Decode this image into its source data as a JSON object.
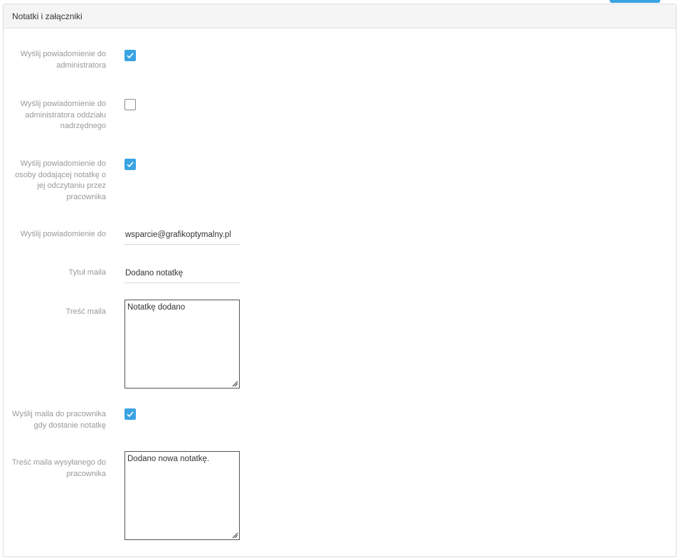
{
  "panel": {
    "title": "Notatki i załączniki"
  },
  "fields": {
    "notify_admin": {
      "label": "Wyślij powiadomienie do administratora",
      "checked": true
    },
    "notify_parent_admin": {
      "label": "Wyślij powiadomienie do administratora oddziału nadrzędnego",
      "checked": false
    },
    "notify_author": {
      "label": "Wyślij powiadomienie do osoby dodającej notatkę o jej odczytaniu przez pracownika",
      "checked": true
    },
    "notify_to": {
      "label": "Wyślij powiadomienie do",
      "value": "wsparcie@grafikoptymalny.pl"
    },
    "mail_title": {
      "label": "Tytuł maila",
      "value": "Dodano notatkę"
    },
    "mail_body": {
      "label": "Treść maila",
      "value": "Notatkę dodano"
    },
    "mail_to_employee": {
      "label": "Wyślij maila do pracownika gdy dostanie notatkę",
      "checked": true
    },
    "employee_mail_body": {
      "label": "Treść maila wysyłanego do pracownika",
      "value": "Dodano nowa notatkę."
    }
  },
  "colors": {
    "accent": "#3aa3e3",
    "label": "#999999",
    "header_bg": "#f5f5f5"
  }
}
